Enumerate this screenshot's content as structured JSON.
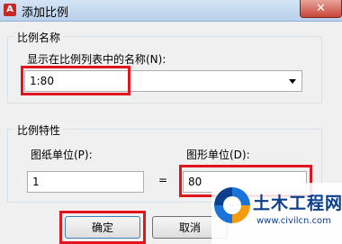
{
  "dialog": {
    "title": "添加比例",
    "close_glyph": "✕"
  },
  "name_group": {
    "legend": "比例名称",
    "field_label": "显示在比例列表中的名称(N):",
    "value": "1:80"
  },
  "props_group": {
    "legend": "比例特性",
    "paper_units_label": "图纸单位(P):",
    "paper_units_value": "1",
    "equals": "=",
    "drawing_units_label": "图形单位(D):",
    "drawing_units_value": "80"
  },
  "buttons": {
    "ok": "确定",
    "cancel": "取消"
  },
  "watermark": {
    "title": "土木工程网",
    "url": "www.civilcn.com"
  },
  "colors": {
    "highlight": "#e0151d",
    "watermark_blue": "#0b3f8c"
  }
}
